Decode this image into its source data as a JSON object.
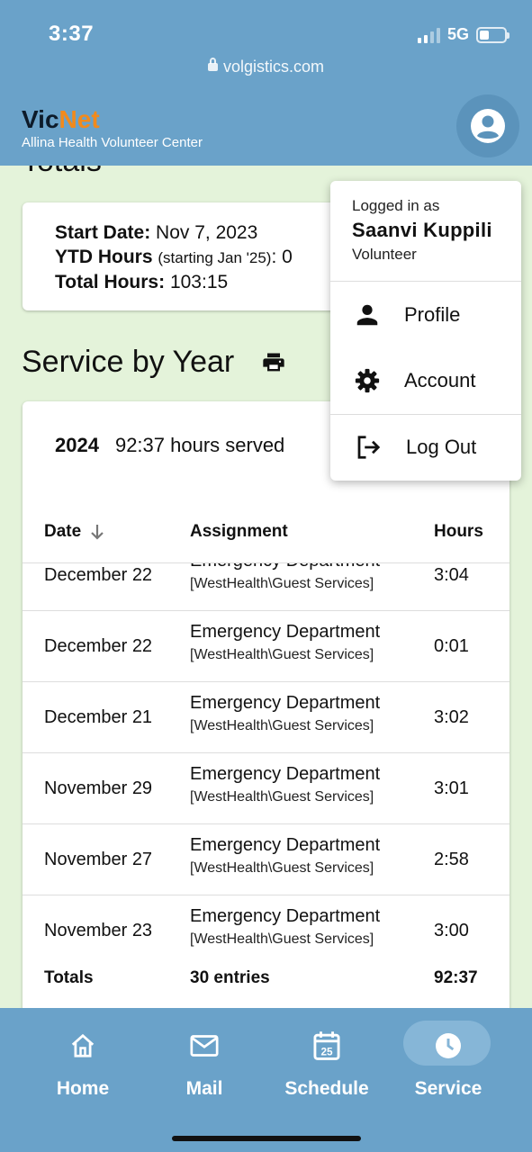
{
  "status": {
    "time": "3:37",
    "network": "5G"
  },
  "browser": {
    "url": "volgistics.com"
  },
  "brand": {
    "name_part1": "Vic",
    "name_part2": "Net",
    "subtitle": "Allina Health Volunteer Center"
  },
  "totals": {
    "heading": "Totals",
    "start_label": "Start Date:",
    "start_value": "Nov 7, 2023",
    "ytd_label": "YTD Hours",
    "ytd_note": "(starting Jan '25)",
    "ytd_value": ": 0",
    "total_label": "Total Hours:",
    "total_value": "103:15"
  },
  "service": {
    "heading": "Service by Year",
    "year": "2024",
    "year_summary": "92:37 hours served",
    "columns": {
      "date": "Date",
      "assignment": "Assignment",
      "hours": "Hours"
    },
    "rows": [
      {
        "date": "December 22",
        "assignment": "Emergency Department",
        "location": "[WestHealth\\Guest Services]",
        "hours": "3:04"
      },
      {
        "date": "December 22",
        "assignment": "Emergency Department",
        "location": "[WestHealth\\Guest Services]",
        "hours": "0:01"
      },
      {
        "date": "December 21",
        "assignment": "Emergency Department",
        "location": "[WestHealth\\Guest Services]",
        "hours": "3:02"
      },
      {
        "date": "November 29",
        "assignment": "Emergency Department",
        "location": "[WestHealth\\Guest Services]",
        "hours": "3:01"
      },
      {
        "date": "November 27",
        "assignment": "Emergency Department",
        "location": "[WestHealth\\Guest Services]",
        "hours": "2:58"
      },
      {
        "date": "November 23",
        "assignment": "Emergency Department",
        "location": "[WestHealth\\Guest Services]",
        "hours": "3:00"
      }
    ],
    "footer": {
      "label": "Totals",
      "entries": "30 entries",
      "hours": "92:37"
    }
  },
  "menu": {
    "logged_in_as": "Logged in as",
    "user_name": "Saanvi Kuppili",
    "role": "Volunteer",
    "profile": "Profile",
    "account": "Account",
    "logout": "Log Out"
  },
  "nav": {
    "home": "Home",
    "mail": "Mail",
    "schedule": "Schedule",
    "schedule_icon_day": "25",
    "service": "Service"
  }
}
